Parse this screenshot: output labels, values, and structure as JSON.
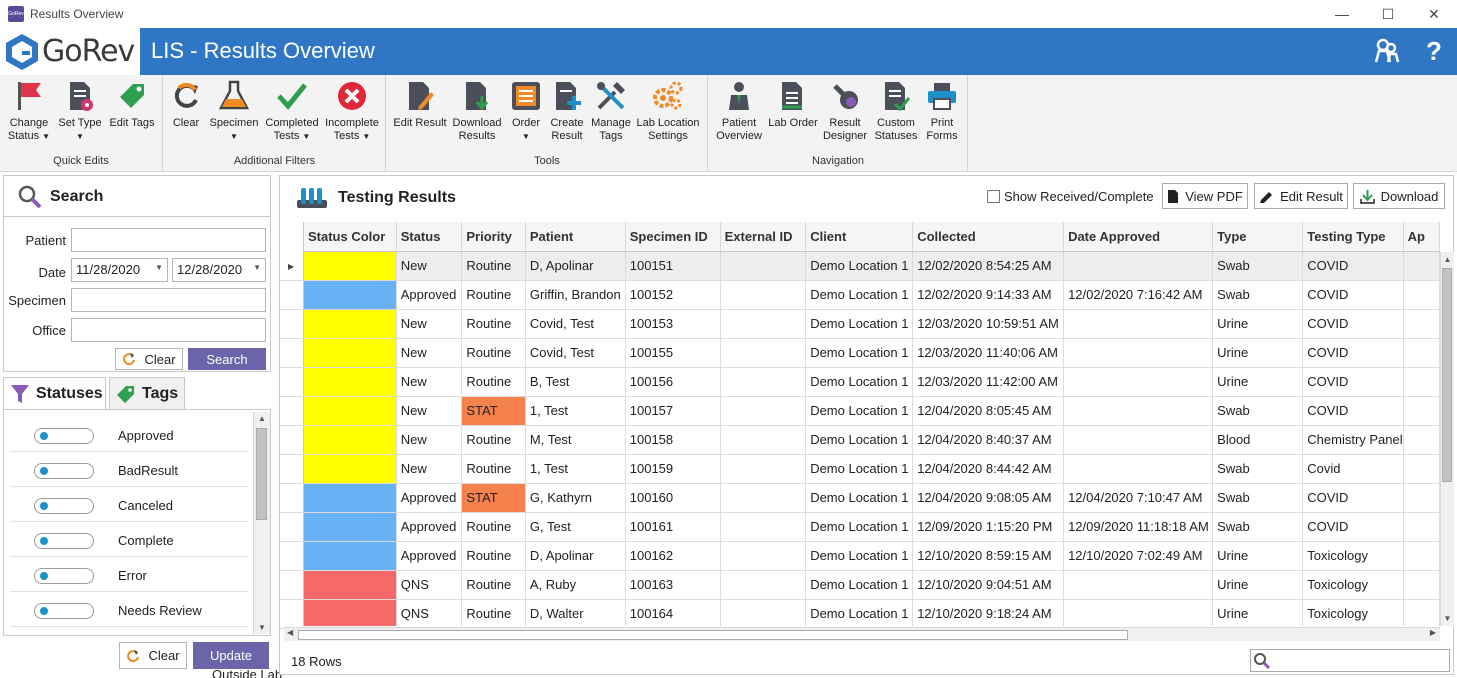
{
  "window": {
    "title": "Results Overview",
    "app_icon_text": "GoRev",
    "controls": [
      "—",
      "☐",
      "✕"
    ]
  },
  "header": {
    "logo_text": "GoRev",
    "title": "LIS - Results Overview",
    "help_label": "?"
  },
  "ribbon": {
    "groups": [
      {
        "label": "Quick Edits",
        "buttons": [
          {
            "label": "Change Status",
            "lines": [
              "Change",
              "Status"
            ],
            "dropdown": true,
            "icon": "flag-icon"
          },
          {
            "label": "Set Type",
            "lines": [
              "Set Type"
            ],
            "dropdown": true,
            "icon": "document-gear-icon"
          },
          {
            "label": "Edit Tags",
            "lines": [
              "Edit Tags"
            ],
            "dropdown": false,
            "icon": "tag-icon"
          }
        ]
      },
      {
        "label": "Additional Filters",
        "buttons": [
          {
            "label": "Clear",
            "lines": [
              "Clear"
            ],
            "dropdown": false,
            "icon": "refresh-icon"
          },
          {
            "label": "Specimen",
            "lines": [
              "Specimen"
            ],
            "dropdown": true,
            "icon": "flask-icon"
          },
          {
            "label": "Completed Tests",
            "lines": [
              "Completed",
              "Tests"
            ],
            "dropdown": true,
            "icon": "checkmark-icon"
          },
          {
            "label": "Incomplete Tests",
            "lines": [
              "Incomplete",
              "Tests"
            ],
            "dropdown": true,
            "icon": "x-circle-icon"
          }
        ]
      },
      {
        "label": "Tools",
        "buttons": [
          {
            "label": "Edit Result",
            "lines": [
              "Edit Result"
            ],
            "dropdown": false,
            "icon": "document-edit-icon"
          },
          {
            "label": "Download Results",
            "lines": [
              "Download",
              "Results"
            ],
            "dropdown": false,
            "icon": "document-download-icon"
          },
          {
            "label": "Order",
            "lines": [
              "Order"
            ],
            "dropdown": true,
            "icon": "order-list-icon"
          },
          {
            "label": "Create Result",
            "lines": [
              "Create",
              "Result"
            ],
            "dropdown": false,
            "icon": "document-add-icon"
          },
          {
            "label": "Manage Tags",
            "lines": [
              "Manage",
              "Tags"
            ],
            "dropdown": false,
            "icon": "tools-icon"
          },
          {
            "label": "Lab Location Settings",
            "lines": [
              "Lab Location",
              "Settings"
            ],
            "dropdown": false,
            "icon": "gears-icon"
          }
        ]
      },
      {
        "label": "Navigation",
        "buttons": [
          {
            "label": "Patient Overview",
            "lines": [
              "Patient",
              "Overview"
            ],
            "dropdown": false,
            "icon": "patient-icon"
          },
          {
            "label": "Lab Order",
            "lines": [
              "Lab Order"
            ],
            "dropdown": false,
            "icon": "lab-order-icon"
          },
          {
            "label": "Result Designer",
            "lines": [
              "Result",
              "Designer"
            ],
            "dropdown": false,
            "icon": "designer-icon"
          },
          {
            "label": "Custom Statuses",
            "lines": [
              "Custom",
              "Statuses"
            ],
            "dropdown": false,
            "icon": "custom-status-icon"
          },
          {
            "label": "Print Forms",
            "lines": [
              "Print",
              "Forms"
            ],
            "dropdown": false,
            "icon": "printer-icon"
          }
        ]
      }
    ]
  },
  "search": {
    "title": "Search",
    "patient_label": "Patient",
    "patient_value": "",
    "date_label": "Date",
    "date_from": "11/28/2020",
    "date_to": "12/28/2020",
    "specimen_label": "Specimen",
    "specimen_value": "",
    "office_label": "Office",
    "office_value": "",
    "clear_label": "Clear",
    "search_label": "Search"
  },
  "filters": {
    "tabs": [
      "Statuses",
      "Tags"
    ],
    "statuses": [
      "Approved",
      "BadResult",
      "Canceled",
      "Complete",
      "Error",
      "Needs Review"
    ],
    "partial_text": "Outside Lab",
    "clear_label": "Clear",
    "update_label": "Update"
  },
  "results": {
    "title": "Testing Results",
    "show_received_label": "Show Received/Complete",
    "show_received_checked": false,
    "view_pdf_label": "View PDF",
    "edit_result_label": "Edit Result",
    "download_label": "Download",
    "columns": [
      "Status Color",
      "Status",
      "Priority",
      "Patient",
      "Specimen ID",
      "External ID",
      "Client",
      "Collected",
      "Date Approved",
      "Type",
      "Testing Type",
      "Ap"
    ],
    "rows": [
      {
        "color": "#ffff00",
        "status": "New",
        "priority": "Routine",
        "priority_color": "",
        "patient": "D, Apolinar",
        "specimen_id": "100151",
        "external_id": "",
        "client": "Demo Location 1",
        "collected": "12/02/2020 8:54:25 AM",
        "approved": "",
        "type": "Swab",
        "testing_type": "COVID"
      },
      {
        "color": "#66b2f5",
        "status": "Approved",
        "priority": "Routine",
        "priority_color": "",
        "patient": "Griffin, Brandon",
        "specimen_id": "100152",
        "external_id": "",
        "client": "Demo Location 1",
        "collected": "12/02/2020 9:14:33 AM",
        "approved": "12/02/2020 7:16:42 AM",
        "type": "Swab",
        "testing_type": "COVID"
      },
      {
        "color": "#ffff00",
        "status": "New",
        "priority": "Routine",
        "priority_color": "",
        "patient": "Covid, Test",
        "specimen_id": "100153",
        "external_id": "",
        "client": "Demo Location 1",
        "collected": "12/03/2020 10:59:51 AM",
        "approved": "",
        "type": "Urine",
        "testing_type": "COVID"
      },
      {
        "color": "#ffff00",
        "status": "New",
        "priority": "Routine",
        "priority_color": "",
        "patient": "Covid, Test",
        "specimen_id": "100155",
        "external_id": "",
        "client": "Demo Location 1",
        "collected": "12/03/2020 11:40:06 AM",
        "approved": "",
        "type": "Urine",
        "testing_type": "COVID"
      },
      {
        "color": "#ffff00",
        "status": "New",
        "priority": "Routine",
        "priority_color": "",
        "patient": "B, Test",
        "specimen_id": "100156",
        "external_id": "",
        "client": "Demo Location 1",
        "collected": "12/03/2020 11:42:00 AM",
        "approved": "",
        "type": "Urine",
        "testing_type": "COVID"
      },
      {
        "color": "#ffff00",
        "status": "New",
        "priority": "STAT",
        "priority_color": "#f5824d",
        "patient": "1, Test",
        "specimen_id": "100157",
        "external_id": "",
        "client": "Demo Location 1",
        "collected": "12/04/2020 8:05:45 AM",
        "approved": "",
        "type": "Swab",
        "testing_type": "COVID"
      },
      {
        "color": "#ffff00",
        "status": "New",
        "priority": "Routine",
        "priority_color": "",
        "patient": "M, Test",
        "specimen_id": "100158",
        "external_id": "",
        "client": "Demo Location 1",
        "collected": "12/04/2020 8:40:37 AM",
        "approved": "",
        "type": "Blood",
        "testing_type": "Chemistry Panel"
      },
      {
        "color": "#ffff00",
        "status": "New",
        "priority": "Routine",
        "priority_color": "",
        "patient": "1, Test",
        "specimen_id": "100159",
        "external_id": "",
        "client": "Demo Location 1",
        "collected": "12/04/2020 8:44:42 AM",
        "approved": "",
        "type": "Swab",
        "testing_type": "Covid"
      },
      {
        "color": "#66b2f5",
        "status": "Approved",
        "priority": "STAT",
        "priority_color": "#f5824d",
        "patient": "G, Kathyrn",
        "specimen_id": "100160",
        "external_id": "",
        "client": "Demo Location 1",
        "collected": "12/04/2020 9:08:05 AM",
        "approved": "12/04/2020 7:10:47 AM",
        "type": "Swab",
        "testing_type": "COVID"
      },
      {
        "color": "#66b2f5",
        "status": "Approved",
        "priority": "Routine",
        "priority_color": "",
        "patient": "G, Test",
        "specimen_id": "100161",
        "external_id": "",
        "client": "Demo Location 1",
        "collected": "12/09/2020 1:15:20 PM",
        "approved": "12/09/2020 11:18:18 AM",
        "type": "Swab",
        "testing_type": "COVID"
      },
      {
        "color": "#66b2f5",
        "status": "Approved",
        "priority": "Routine",
        "priority_color": "",
        "patient": "D, Apolinar",
        "specimen_id": "100162",
        "external_id": "",
        "client": "Demo Location 1",
        "collected": "12/10/2020 8:59:15 AM",
        "approved": "12/10/2020 7:02:49 AM",
        "type": "Urine",
        "testing_type": "Toxicology"
      },
      {
        "color": "#f76868",
        "status": "QNS",
        "priority": "Routine",
        "priority_color": "",
        "patient": "A, Ruby",
        "specimen_id": "100163",
        "external_id": "",
        "client": "Demo Location 1",
        "collected": "12/10/2020 9:04:51 AM",
        "approved": "",
        "type": "Urine",
        "testing_type": "Toxicology"
      },
      {
        "color": "#f76868",
        "status": "QNS",
        "priority": "Routine",
        "priority_color": "",
        "patient": "D, Walter",
        "specimen_id": "100164",
        "external_id": "",
        "client": "Demo Location 1",
        "collected": "12/10/2020 9:18:24 AM",
        "approved": "",
        "type": "Urine",
        "testing_type": "Toxicology"
      }
    ],
    "row_count_text": "18 Rows",
    "grid_search_value": ""
  },
  "colors": {
    "header_blue": "#2f77c4",
    "button_purple": "#6c64a8",
    "status_new": "#ffff00",
    "status_approved": "#66b2f5",
    "status_qns": "#f76868",
    "priority_stat": "#f5824d"
  }
}
